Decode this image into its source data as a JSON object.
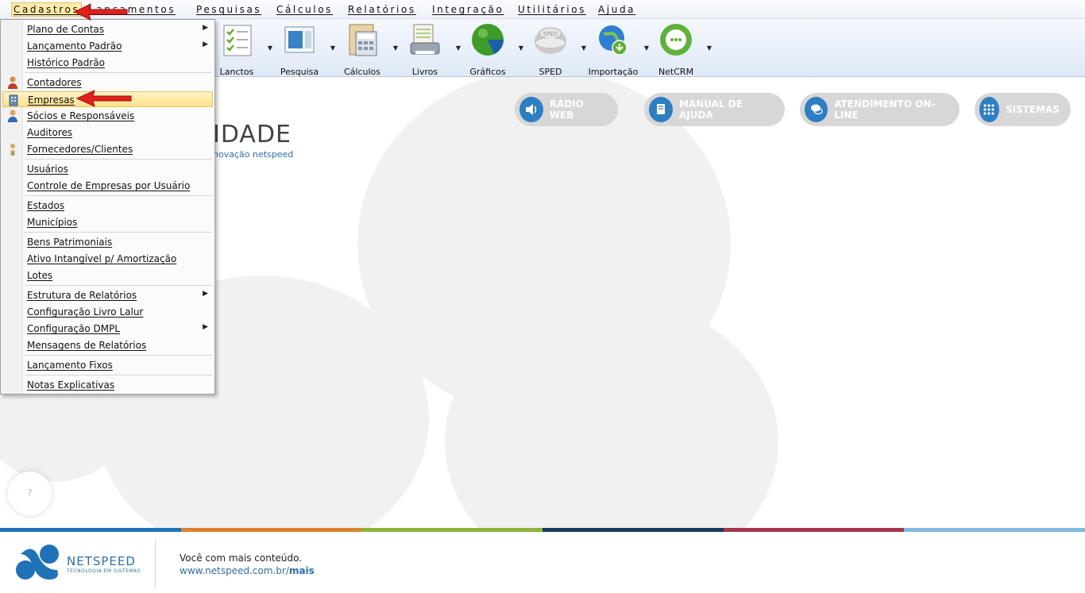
{
  "menubar": {
    "items": [
      {
        "label": "Cadastros"
      },
      {
        "label": "Lançamentos"
      },
      {
        "label": "Pesquisas"
      },
      {
        "label": "Cálculos"
      },
      {
        "label": "Relatórios"
      },
      {
        "label": "Integração"
      },
      {
        "label": "Utilitários"
      },
      {
        "label": "Ajuda"
      }
    ]
  },
  "toolbar": {
    "buttons": [
      {
        "label": "Lanctos",
        "icon": "checklist-icon"
      },
      {
        "label": "Pesquisa",
        "icon": "document-search-icon"
      },
      {
        "label": "Cálculos",
        "icon": "calculator-icon"
      },
      {
        "label": "Livros",
        "icon": "printer-book-icon"
      },
      {
        "label": "Gráficos",
        "icon": "pie-chart-icon"
      },
      {
        "label": "SPED",
        "icon": "sped-icon"
      },
      {
        "label": "Importação",
        "icon": "globe-download-icon"
      },
      {
        "label": "NetCRM",
        "icon": "chat-bubble-icon"
      }
    ]
  },
  "dropdown": {
    "groups": [
      [
        {
          "label": "Plano de Contas",
          "submenu": true
        },
        {
          "label": "Lançamento Padrão",
          "submenu": true
        },
        {
          "label": "Histórico Padrão",
          "submenu": false
        }
      ],
      [
        {
          "label": "Contadores",
          "submenu": false,
          "icon": "person-icon"
        },
        {
          "label": "Empresas",
          "submenu": false,
          "icon": "building-icon",
          "highlighted": true
        },
        {
          "label": "Sócios e Responsáveis",
          "submenu": false,
          "icon": "person-blue-icon"
        },
        {
          "label": "Auditores",
          "submenu": false
        },
        {
          "label": "Fornecedores/Clientes",
          "submenu": false,
          "icon": "person-tie-icon"
        }
      ],
      [
        {
          "label": "Usuários",
          "submenu": false
        },
        {
          "label": "Controle de Empresas por Usuário",
          "submenu": false
        }
      ],
      [
        {
          "label": "Estados",
          "submenu": false
        },
        {
          "label": "Municípios",
          "submenu": false
        }
      ],
      [
        {
          "label": "Bens Patrimoniais",
          "submenu": false
        },
        {
          "label": "Ativo Intangível p/ Amortização",
          "submenu": false
        },
        {
          "label": "Lotes",
          "submenu": false
        }
      ],
      [
        {
          "label": "Estrutura de Relatórios",
          "submenu": true
        },
        {
          "label": "Configuração Livro Lalur",
          "submenu": false
        },
        {
          "label": "Configuração DMPL",
          "submenu": true
        },
        {
          "label": "Mensagens de Relatórios",
          "submenu": false
        }
      ],
      [
        {
          "label": "Lançamento Fixos",
          "submenu": false
        }
      ],
      [
        {
          "label": "Notas Explicativas",
          "submenu": false
        }
      ]
    ]
  },
  "main": {
    "pills": [
      {
        "label": "RÁDIO WEB",
        "icon": "speaker-icon"
      },
      {
        "label": "MANUAL DE AJUDA",
        "icon": "book-icon"
      },
      {
        "label": "ATENDIMENTO ON-LINE",
        "icon": "chat-icon"
      },
      {
        "label": "SISTEMAS",
        "icon": "grid-dots-icon"
      }
    ],
    "brand_visible": "IDADE",
    "brand_sub_visible": "novação netspeed",
    "help_label": "?"
  },
  "footer": {
    "logo_name": "NETSPEED",
    "logo_tagline": "TECNOLOGIA EM SISTEMAS",
    "message": "Você com mais conteúdo.",
    "link_prefix": "www.netspeed.com.br/",
    "link_suffix": "mais",
    "stripe_colors": [
      "#1f71b8",
      "#d9822b",
      "#8cb43c",
      "#123d5e",
      "#a8344c",
      "#7fb8e0"
    ]
  }
}
